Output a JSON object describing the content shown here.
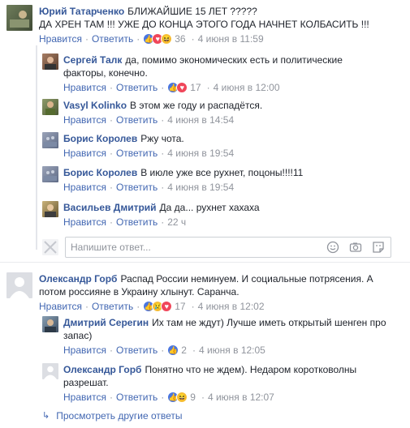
{
  "comments": [
    {
      "author": "Юрий Татарченко",
      "text": "БЛИЖАЙШИЕ 15 ЛЕТ ?????",
      "text2": "ДА ХРЕН ТАМ !!! УЖЕ ДО КОНЦА ЭТОГО ГОДА НАЧНЕТ КОЛБАСИТЬ !!!",
      "like": "Нравится",
      "reply": "Ответить",
      "reactions": "36",
      "time": "4 июня в 11:59"
    },
    {
      "author": "Сергей Талк",
      "text": "да, помимо экономических есть и политические",
      "text2": "факторы, конечно.",
      "like": "Нравится",
      "reply": "Ответить",
      "reactions": "17",
      "time": "4 июня в 12:00"
    },
    {
      "author": "Vasyl Kolinko",
      "text": "В этом же году и распадётся.",
      "like": "Нравится",
      "reply": "Ответить",
      "time": "4 июня в 14:54"
    },
    {
      "author": "Борис Королев",
      "text": "Ржу чота.",
      "like": "Нравится",
      "reply": "Ответить",
      "time": "4 июня в 19:54"
    },
    {
      "author": "Борис Королев",
      "text": "В июле уже все рухнет, поцоны!!!!11",
      "like": "Нравится",
      "reply": "Ответить",
      "time": "4 июня в 19:54"
    },
    {
      "author": "Васильев Дмитрий",
      "text": "Да да... рухнет хахаха",
      "like": "Нравится",
      "reply": "Ответить",
      "time": "22 ч"
    },
    {
      "author": "Олександр Горб",
      "text": "Распад России неминуем. И социальные потрясения. А",
      "text2": "потом россияне в Украину хлынут. Саранча.",
      "like": "Нравится",
      "reply": "Ответить",
      "reactions": "17",
      "time": "4 июня в 12:02"
    },
    {
      "author": "Дмитрий Серегин",
      "text": "Их там не ждут) Лучше иметь открытый шенген про",
      "text2": "запас)",
      "like": "Нравится",
      "reply": "Ответить",
      "reactions": "2",
      "time": "4 июня в 12:05"
    },
    {
      "author": "Олександр Горб",
      "text": "Понятно что не ждем). Недаром коротковолны",
      "text2": "разрешат.",
      "like": "Нравится",
      "reply": "Ответить",
      "reactions": "9",
      "time": "4 июня в 12:07"
    }
  ],
  "reply_box": {
    "placeholder": "Напишите ответ..."
  },
  "more_link": "Просмотреть другие ответы",
  "colors": {
    "link": "#4267b2",
    "author": "#365899",
    "meta": "#90949c",
    "like": "#4a76e0",
    "love": "#f0465a",
    "haha": "#f7c23c"
  }
}
